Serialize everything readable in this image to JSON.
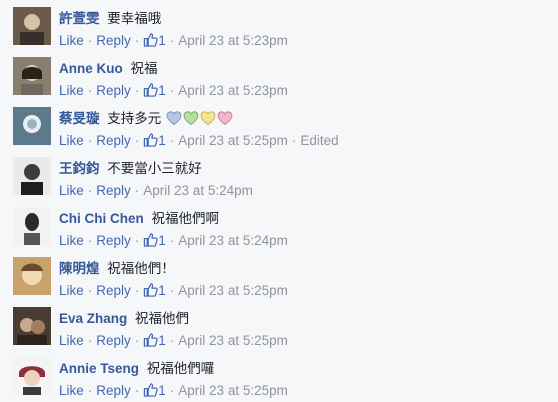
{
  "comments": [
    {
      "author": "許萱雯",
      "text": "要幸福哦",
      "like": "Like",
      "reply": "Reply",
      "like_count": "1",
      "time": "April 23 at 5:23pm",
      "avatar_color": "#6b5a4a"
    },
    {
      "author": "Anne Kuo",
      "text": "祝福",
      "like": "Like",
      "reply": "Reply",
      "like_count": "1",
      "time": "April 23 at 5:23pm",
      "avatar_color": "#8a7f6e"
    },
    {
      "author": "蔡旻璇",
      "text": "支持多元",
      "like": "Like",
      "reply": "Reply",
      "like_count": "1",
      "time": "April 23 at 5:25pm",
      "edited": "Edited",
      "avatar_color": "#5d7a8c",
      "hearts": [
        {
          "icon": "heart-icon",
          "color": "#b9c7e6"
        },
        {
          "icon": "heart-icon",
          "color": "#b6e0a2"
        },
        {
          "icon": "heart-icon",
          "color": "#f5e38f"
        },
        {
          "icon": "heart-icon",
          "color": "#f1b6c8"
        }
      ]
    },
    {
      "author": "王鈞鈞",
      "text": "不要當小三就好",
      "like": "Like",
      "reply": "Reply",
      "time": "April 23 at 5:24pm",
      "avatar_color": "#3c3c3c"
    },
    {
      "author": "Chi Chi Chen",
      "text": "祝福他們啊",
      "like": "Like",
      "reply": "Reply",
      "like_count": "1",
      "time": "April 23 at 5:24pm",
      "avatar_color": "#2b2b2b"
    },
    {
      "author": "陳明煌",
      "text": "祝福他們！",
      "like": "Like",
      "reply": "Reply",
      "like_count": "1",
      "time": "April 23 at 5:25pm",
      "avatar_color": "#c9a36b"
    },
    {
      "author": "Eva Zhang",
      "text": "祝福他們",
      "like": "Like",
      "reply": "Reply",
      "like_count": "1",
      "time": "April 23 at 5:25pm",
      "avatar_color": "#4a3b33"
    },
    {
      "author": "Annie Tseng",
      "text": "祝福他們囉",
      "like": "Like",
      "reply": "Reply",
      "like_count": "1",
      "time": "April 23 at 5:25pm",
      "avatar_color": "#8c2f3a"
    }
  ],
  "colors": {
    "link": "#4267b2",
    "author": "#365899",
    "meta": "#90949c",
    "background": "#f6f7f9"
  },
  "icons": {
    "like": "thumbs-up-icon"
  }
}
